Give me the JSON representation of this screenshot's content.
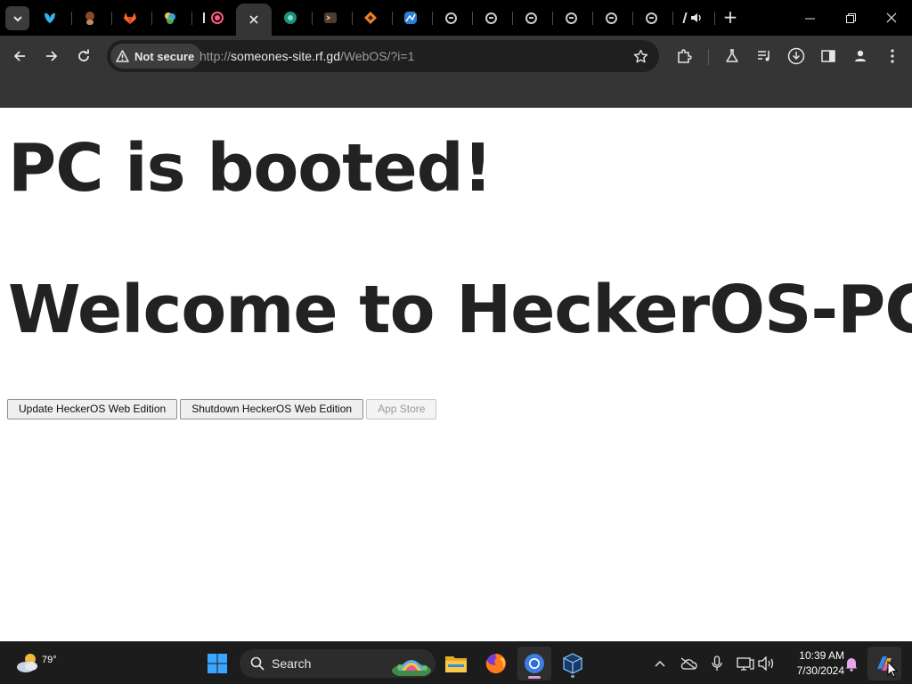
{
  "browser": {
    "tabs": [
      {
        "icon": "app-icon-blue-butterfly"
      },
      {
        "icon": "app-icon-brown-avatar"
      },
      {
        "icon": "gitlab-icon"
      },
      {
        "icon": "app-icon-multicolor"
      },
      {
        "icon": "record-icon"
      },
      {
        "icon": "active-tab-close-icon",
        "active": true
      },
      {
        "icon": "app-icon-teal-circle"
      },
      {
        "icon": "app-icon-terminal"
      },
      {
        "icon": "app-icon-orange-diamond"
      },
      {
        "icon": "app-icon-blue-square"
      },
      {
        "icon": "globe-icon"
      },
      {
        "icon": "globe-icon"
      },
      {
        "icon": "globe-icon"
      },
      {
        "icon": "globe-icon"
      },
      {
        "icon": "globe-icon"
      },
      {
        "icon": "globe-icon"
      },
      {
        "icon": "audio-playing-icon"
      }
    ],
    "security_label": "Not secure",
    "url": {
      "scheme": "http://",
      "host": "someones-site.rf.gd",
      "path": "/WebOS/?i=1"
    }
  },
  "page": {
    "heading_1": "PC is booted!",
    "heading_2": "Welcome to HeckerOS-PC.",
    "buttons": {
      "update": "Update HeckerOS Web Edition",
      "shutdown": "Shutdown HeckerOS Web Edition",
      "app_store": "App Store"
    }
  },
  "taskbar": {
    "weather_temp": "79°",
    "search_label": "Search",
    "clock_time": "10:39 AM",
    "clock_date": "7/30/2024"
  },
  "colors": {
    "tabstrip": "#000000",
    "toolbar": "#353535",
    "omnibox": "#1f1f1f",
    "page_text": "#222222",
    "taskbar": "#1c1c1c"
  }
}
